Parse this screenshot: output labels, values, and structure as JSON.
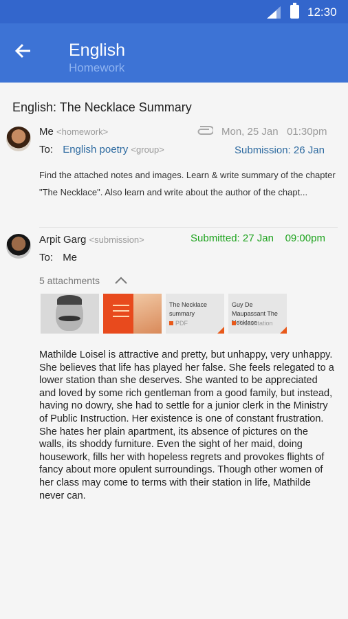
{
  "status_bar": {
    "time": "12:30",
    "signal_icon": "signal-icon",
    "battery_icon": "battery-icon"
  },
  "app_bar": {
    "title": "English",
    "subtitle": "Homework",
    "back_icon": "arrow-back-icon"
  },
  "thread": {
    "subject": "English: The Necklace Summary",
    "message": {
      "sender": "Me",
      "sender_tag": "<homework>",
      "attachment_icon": "paperclip-icon",
      "date": "Mon, 25 Jan",
      "time": "01:30pm",
      "to_label": "To:",
      "recipient": "English poetry",
      "recipient_tag": "<group>",
      "submission": "Submission: 26 Jan",
      "body": "Find the attached notes and images. Learn & write summary of the chapter  \"The Necklace\". Also learn and write about the author of the chapt..."
    },
    "reply": {
      "sender": "Arpit Garg",
      "sender_tag": "<submission>",
      "submitted": "Submitted: 27 Jan    09:00pm",
      "to_label": "To:",
      "recipient": "Me",
      "attachments_label": "5 attachments",
      "attachments": [
        {
          "kind": "image",
          "name": "author-portrait"
        },
        {
          "kind": "image",
          "name": "book-cover"
        },
        {
          "kind": "doc",
          "title": "The Necklace summary",
          "type": "PDF"
        },
        {
          "kind": "doc",
          "title": "Guy De Maupassant The Necklace",
          "type": "Presentation"
        }
      ],
      "body": "Mathilde Loisel is attractive and pretty, but unhappy, very unhappy. She believes that life has played her false. She feels relegated to a lower station than she deserves. She wanted to be appreciated and loved by some rich gentleman from a good family, but instead, having no dowry, she had to settle for a junior clerk in the Ministry of Public Instruction. Her existence is one of constant frustration. She hates her plain apartment, its absence of pictures on the walls, its shoddy furniture. Even the sight of her maid, doing housework, fills her with hopeless regrets and provokes flights of fancy about more opulent surroundings. Though other women of her class may come to terms with their station in life, Mathilde never can."
    }
  },
  "colors": {
    "status_bar": "#3366cc",
    "app_bar": "#3d73d5",
    "link": "#2d6aa0",
    "submitted": "#1ea31e",
    "doc_accent": "#e8591a"
  }
}
